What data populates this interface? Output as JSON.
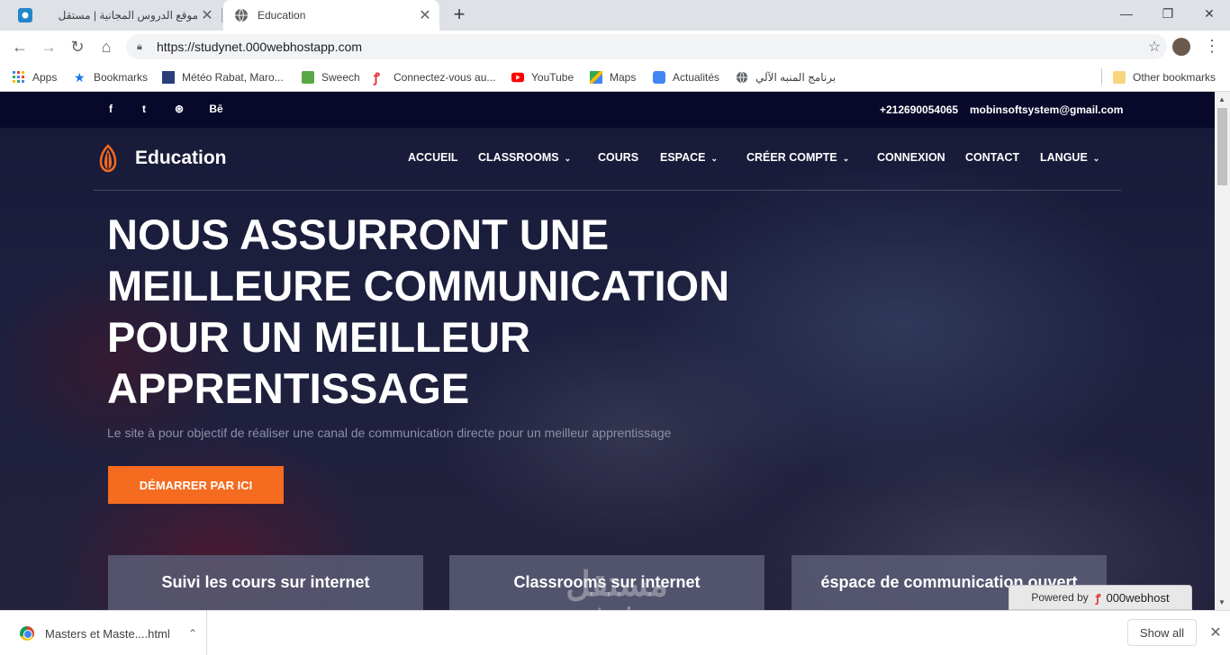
{
  "browser": {
    "tabs": [
      {
        "title": "موقع الدروس المجانية | مستقل",
        "favicon": "mostaql-favicon",
        "close": "✕"
      },
      {
        "title": "Education",
        "favicon": "globe-favicon",
        "close": "✕"
      }
    ],
    "new_tab": "+",
    "window_controls": {
      "minimize": "—",
      "restore": "❐",
      "close": "✕"
    },
    "url": "https://studynet.000webhostapp.com",
    "bookmarks": [
      {
        "label": "Apps",
        "icon": "apps-grid-icon"
      },
      {
        "label": "Bookmarks",
        "icon": "star-icon"
      },
      {
        "label": "Météo Rabat, Maro...",
        "icon": "weather-icon"
      },
      {
        "label": "Sweech",
        "icon": "sweech-icon"
      },
      {
        "label": "Connectez-vous au...",
        "icon": "swirl-icon"
      },
      {
        "label": "YouTube",
        "icon": "youtube-icon"
      },
      {
        "label": "Maps",
        "icon": "maps-icon"
      },
      {
        "label": "Actualités",
        "icon": "news-icon"
      },
      {
        "label": "برنامج المنبه الآلي",
        "icon": "globe-icon"
      },
      {
        "label": "Other bookmarks",
        "icon": "folder-icon"
      }
    ]
  },
  "site": {
    "topbar": {
      "social": [
        "f",
        "t",
        "⊛",
        "Bē"
      ],
      "phone": "+212690054065",
      "email": "mobinsoftsystem@gmail.com"
    },
    "logo_text": "Education",
    "nav": [
      {
        "label": "ACCUEIL",
        "dropdown": false
      },
      {
        "label": "CLASSROOMS",
        "dropdown": true
      },
      {
        "label": "COURS",
        "dropdown": false
      },
      {
        "label": "ESPACE",
        "dropdown": true
      },
      {
        "label": "CRÉER COMPTE",
        "dropdown": true
      },
      {
        "label": "CONNEXION",
        "dropdown": false
      },
      {
        "label": "CONTACT",
        "dropdown": false
      },
      {
        "label": "LANGUE",
        "dropdown": true
      }
    ],
    "hero": {
      "headline": "NOUS ASSURRONT UNE MEILLEURE COMMUNICATION POUR UN MEILLEUR APPRENTISSAGE",
      "subtitle": "Le site à pour objectif de réaliser une canal de communication directe pour un meilleur apprentissage",
      "cta": "DÉMARRER PAR ICI"
    },
    "features": [
      "Suivi les cours sur internet",
      "Classrooms sur internet",
      "éspace de communication ouvert"
    ],
    "powered_by": {
      "prefix": "Powered by",
      "brand": "000webhost"
    },
    "watermark": {
      "arabic": "مستقل",
      "latin": "mostaql.com"
    }
  },
  "downloads": {
    "file": "Masters et Maste....html",
    "show_all": "Show all",
    "close": "✕"
  },
  "colors": {
    "accent": "#f56b1f",
    "topbar": "#08092a",
    "feature_box": "#5a5c76"
  }
}
